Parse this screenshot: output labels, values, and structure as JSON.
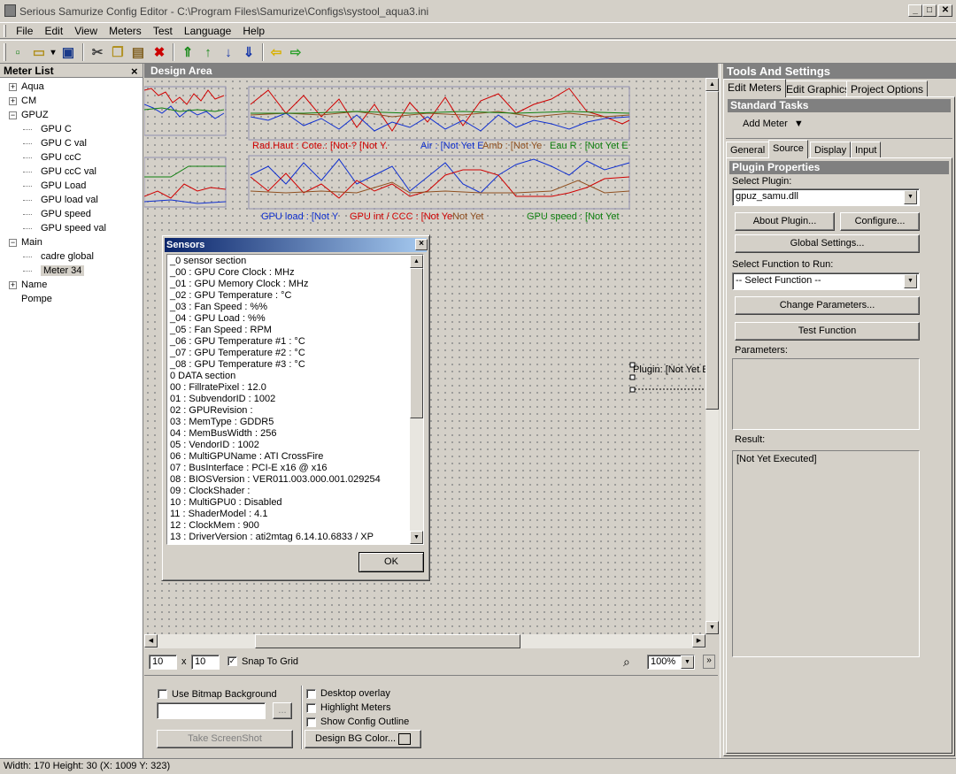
{
  "window": {
    "title": "Serious Samurize Config Editor - C:\\Program Files\\Samurize\\Configs\\systool_aqua3.ini",
    "min": "_",
    "max": "□",
    "close": "✕"
  },
  "menu": [
    "File",
    "Edit",
    "View",
    "Meters",
    "Test",
    "Language",
    "Help"
  ],
  "toolbar": [
    {
      "icon": "new-file-icon",
      "glyph": "▫",
      "color": "#2a8a2a"
    },
    {
      "icon": "open-folder-icon",
      "glyph": "▭",
      "color": "#b09020"
    },
    {
      "icon": "dropdown-arrow-icon",
      "glyph": "▾",
      "color": "#000"
    },
    {
      "icon": "save-disk-icon",
      "glyph": "▣",
      "color": "#1a3a8a"
    },
    {
      "icon": "cut-icon",
      "glyph": "✂",
      "color": "#404040"
    },
    {
      "icon": "copy-icon",
      "glyph": "❐",
      "color": "#b09020"
    },
    {
      "icon": "paste-icon",
      "glyph": "▤",
      "color": "#806020"
    },
    {
      "icon": "delete-icon",
      "glyph": "✖",
      "color": "#cc0000"
    },
    {
      "icon": "move-top-icon",
      "glyph": "⇑",
      "color": "#1a8a1a"
    },
    {
      "icon": "move-up-icon",
      "glyph": "↑",
      "color": "#1a8a1a"
    },
    {
      "icon": "move-down-icon",
      "glyph": "↓",
      "color": "#1a3aaa"
    },
    {
      "icon": "move-bottom-icon",
      "glyph": "⇓",
      "color": "#1a3aaa"
    },
    {
      "icon": "arrow-left-icon",
      "glyph": "⇦",
      "color": "#d8b000"
    },
    {
      "icon": "arrow-right-icon",
      "glyph": "⇨",
      "color": "#2aa02a"
    }
  ],
  "meter_list": {
    "title": "Meter List",
    "close": "×",
    "items": [
      {
        "label": "Aqua",
        "level": 0,
        "expander": "+"
      },
      {
        "label": "CM",
        "level": 0,
        "expander": "+"
      },
      {
        "label": "GPUZ",
        "level": 0,
        "expander": "−"
      },
      {
        "label": "GPU C",
        "level": 1
      },
      {
        "label": "GPU C val",
        "level": 1
      },
      {
        "label": "GPU ccC",
        "level": 1
      },
      {
        "label": "GPU ccC val",
        "level": 1
      },
      {
        "label": "GPU Load",
        "level": 1
      },
      {
        "label": "GPU load val",
        "level": 1
      },
      {
        "label": "GPU speed",
        "level": 1
      },
      {
        "label": "GPU speed val",
        "level": 1
      },
      {
        "label": "Main",
        "level": 0,
        "expander": "−"
      },
      {
        "label": "cadre global",
        "level": 1
      },
      {
        "label": "Meter 34",
        "level": 1,
        "selected": true
      },
      {
        "label": "Name",
        "level": 0,
        "expander": "+"
      },
      {
        "label": "Pompe",
        "level": 0
      }
    ]
  },
  "design": {
    "title": "Design Area",
    "chart_texts": [
      {
        "text": "Rad.Haut : Cote.: [Not-? [Not Y.",
        "color": "#d00000"
      },
      {
        "text": "Air : [Not Yet E",
        "color": "#1030d0"
      },
      {
        "text": "Amb : [Not Ye",
        "color": "#905020"
      },
      {
        "text": "Eau R : [Not Yet E",
        "color": "#108010"
      },
      {
        "text": "GPU load : [Not Y",
        "color": "#1030d0"
      },
      {
        "text": "GPU int / CCC : [Not Ye",
        "color": "#d00000"
      },
      {
        "text": "Not Yet",
        "color": "#905020"
      },
      {
        "text": "GPU speed : [Not Yet",
        "color": "#108010"
      },
      {
        "text": "Plugin: [Not Yet E",
        "color": "#000000"
      }
    ],
    "grid_x": "10",
    "grid_y": "10",
    "x_sep": "x",
    "snap_label": "Snap To Grid",
    "snap_checked": true,
    "zoom": "100%",
    "use_bitmap": "Use Bitmap Background",
    "desktop_overlay": "Desktop overlay",
    "highlight_meters": "Highlight Meters",
    "show_outline": "Show Config Outline",
    "browse": "...",
    "take_screenshot": "Take ScreenShot",
    "bg_color": "Design BG Color..."
  },
  "sensors": {
    "title": "Sensors",
    "ok": "OK",
    "items": [
      "_0 sensor section",
      "_00 : GPU Core Clock : MHz",
      "_01 : GPU Memory Clock : MHz",
      "_02 : GPU Temperature : °C",
      "_03 : Fan Speed : %%",
      "_04 : GPU Load : %%",
      "_05 : Fan Speed : RPM",
      "_06 : GPU Temperature #1 : °C",
      "_07 : GPU Temperature #2 : °C",
      "_08 : GPU Temperature #3 : °C",
      "0 DATA section",
      "00 : FillratePixel : 12.0",
      "01 : SubvendorID : 1002",
      "02 : GPURevision :",
      "03 : MemType : GDDR5",
      "04 : MemBusWidth : 256",
      "05 : VendorID : 1002",
      "06 : MultiGPUName : ATI CrossFire",
      "07 : BusInterface : PCI-E x16 @ x16",
      "08 : BIOSVersion : VER011.003.000.001.029254",
      "09 : ClockShader :",
      "10 : MultiGPU0 : Disabled",
      "11 : ShaderModel : 4.1",
      "12 : ClockMem : 900",
      "13 : DriverVersion : ati2mtag 6.14.10.6833  / XP"
    ]
  },
  "tools": {
    "title": "Tools And Settings",
    "tabs": [
      "Edit Meters",
      "Edit Graphics",
      "Project Options"
    ],
    "standard_tasks": "Standard Tasks",
    "add_meter": "Add Meter",
    "subtabs": [
      "General",
      "Source",
      "Display",
      "Input"
    ],
    "plugin_properties": "Plugin Properties",
    "select_plugin_label": "Select Plugin:",
    "plugin_value": "gpuz_samu.dll",
    "about_plugin": "About Plugin...",
    "configure": "Configure...",
    "global_settings": "Global Settings...",
    "select_function_label": "Select Function to Run:",
    "function_value": "-- Select Function --",
    "change_parameters": "Change Parameters...",
    "test_function": "Test Function",
    "parameters_label": "Parameters:",
    "result_label": "Result:",
    "result_value": "[Not Yet Executed]"
  },
  "status": "Width: 170  Height: 30  (X: 1009  Y: 323)"
}
